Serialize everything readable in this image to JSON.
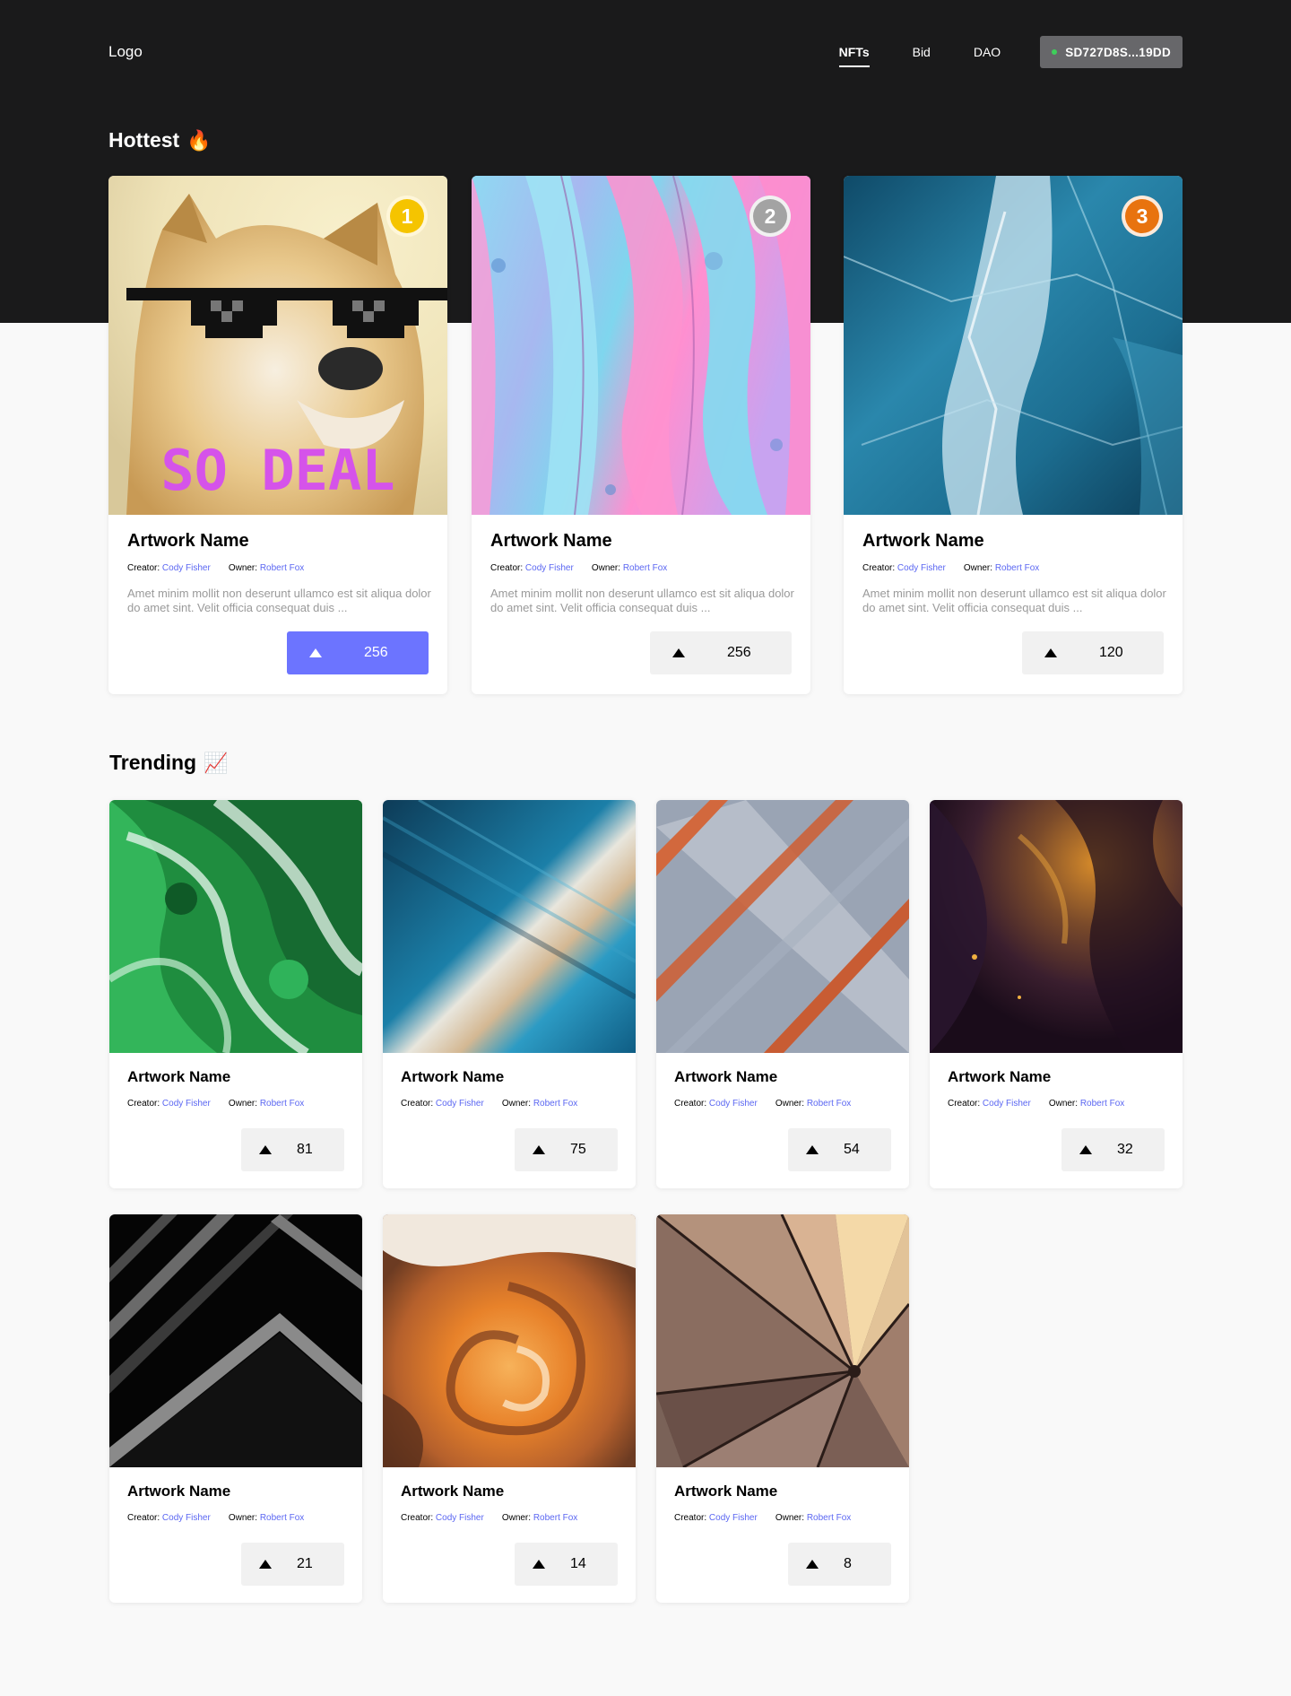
{
  "header": {
    "logo": "Logo",
    "nav": [
      {
        "label": "NFTs",
        "active": true
      },
      {
        "label": "Bid",
        "active": false
      },
      {
        "label": "DAO",
        "active": false
      }
    ],
    "wallet": "SD727D8S...19DD"
  },
  "colors": {
    "dark_bg": "#1a1a1b",
    "accent": "#6c74ff",
    "link": "#5b67f2",
    "gold": "#f5c400",
    "silver": "#a3a3a3",
    "bronze": "#e8730f"
  },
  "hottest": {
    "title": "Hottest",
    "emoji": "🔥",
    "cards": [
      {
        "rank": "1",
        "title": "Artwork Name",
        "creator_label": "Creator:",
        "creator": "Cody Fisher",
        "owner_label": "Owner:",
        "owner": "Robert Fox",
        "description": "Amet minim mollit non deserunt ullamco est sit aliqua dolor do amet sint. Velit officia consequat duis ...",
        "votes": "256",
        "art_text": "SO DEAL"
      },
      {
        "rank": "2",
        "title": "Artwork Name",
        "creator_label": "Creator:",
        "creator": "Cody Fisher",
        "owner_label": "Owner:",
        "owner": "Robert Fox",
        "description": "Amet minim mollit non deserunt ullamco est sit aliqua dolor do amet sint. Velit officia consequat duis ...",
        "votes": "256"
      },
      {
        "rank": "3",
        "title": "Artwork Name",
        "creator_label": "Creator:",
        "creator": "Cody Fisher",
        "owner_label": "Owner:",
        "owner": "Robert Fox",
        "description": "Amet minim mollit non deserunt ullamco est sit aliqua dolor do amet sint. Velit officia consequat duis ...",
        "votes": "120"
      }
    ]
  },
  "trending": {
    "title": "Trending",
    "emoji": "📈",
    "cards": [
      {
        "title": "Artwork Name",
        "creator_label": "Creator:",
        "creator": "Cody Fisher",
        "owner_label": "Owner:",
        "owner": "Robert Fox",
        "votes": "81"
      },
      {
        "title": "Artwork Name",
        "creator_label": "Creator:",
        "creator": "Cody Fisher",
        "owner_label": "Owner:",
        "owner": "Robert Fox",
        "votes": "75"
      },
      {
        "title": "Artwork Name",
        "creator_label": "Creator:",
        "creator": "Cody Fisher",
        "owner_label": "Owner:",
        "owner": "Robert Fox",
        "votes": "54"
      },
      {
        "title": "Artwork Name",
        "creator_label": "Creator:",
        "creator": "Cody Fisher",
        "owner_label": "Owner:",
        "owner": "Robert Fox",
        "votes": "32"
      },
      {
        "title": "Artwork Name",
        "creator_label": "Creator:",
        "creator": "Cody Fisher",
        "owner_label": "Owner:",
        "owner": "Robert Fox",
        "votes": "21"
      },
      {
        "title": "Artwork Name",
        "creator_label": "Creator:",
        "creator": "Cody Fisher",
        "owner_label": "Owner:",
        "owner": "Robert Fox",
        "votes": "14"
      },
      {
        "title": "Artwork Name",
        "creator_label": "Creator:",
        "creator": "Cody Fisher",
        "owner_label": "Owner:",
        "owner": "Robert Fox",
        "votes": "8"
      }
    ]
  }
}
